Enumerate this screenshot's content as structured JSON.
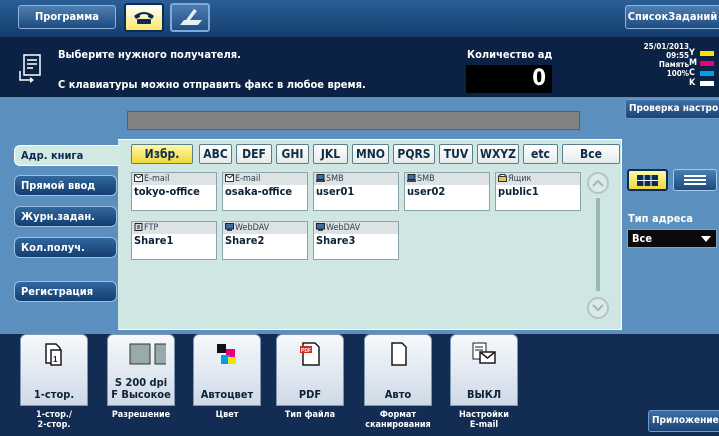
{
  "header": {
    "program_label": "Программа",
    "jobs_label": "СписокЗаданий"
  },
  "message": {
    "line1": "Выберите нужного получателя.",
    "line2": "С клавиатуры можно отправить факс в любое время.",
    "count_label": "Количество ад",
    "count_value": "0"
  },
  "status": {
    "date": "25/01/2013",
    "time": "09:55",
    "memory_label": "Память",
    "memory_value": "100%",
    "toners": [
      {
        "label": "Y",
        "color": "#f2e600"
      },
      {
        "label": "M",
        "color": "#e6007e"
      },
      {
        "label": "C",
        "color": "#00a0e9"
      },
      {
        "label": "K",
        "color": "#ffffff"
      }
    ]
  },
  "check_label": "Проверка настро",
  "nav": {
    "addrbook": "Адр. книга",
    "direct": "Прямой ввод",
    "journal": "Журн.задан.",
    "count": "Кол.получ.",
    "register": "Регистрация"
  },
  "tabs": [
    "Избр.",
    "ABC",
    "DEF",
    "GHI",
    "JKL",
    "MNO",
    "PQRS",
    "TUV",
    "WXYZ",
    "etc",
    "Все"
  ],
  "destinations": [
    {
      "type": "E-mail",
      "name": "tokyo-office",
      "icon": "email-icon"
    },
    {
      "type": "E-mail",
      "name": "osaka-office",
      "icon": "email-icon"
    },
    {
      "type": "SMB",
      "name": "user01",
      "icon": "smb-icon"
    },
    {
      "type": "SMB",
      "name": "user02",
      "icon": "smb-icon"
    },
    {
      "type": "Ящик",
      "name": "public1",
      "icon": "box-icon"
    },
    {
      "type": "FTP",
      "name": "Share1",
      "icon": "ftp-icon"
    },
    {
      "type": "WebDAV",
      "name": "Share2",
      "icon": "webdav-icon"
    },
    {
      "type": "WebDAV",
      "name": "Share3",
      "icon": "webdav-icon"
    }
  ],
  "address_type": {
    "label": "Тип адреса",
    "value": "Все"
  },
  "settings": [
    {
      "value_line1": "1-стор.",
      "value_line2": "",
      "label_line1": "1-стор./",
      "label_line2": "2-стор.",
      "icon": "simplex-icon"
    },
    {
      "value_line1": "S 200 dpi",
      "value_line2": "F Высокое",
      "label_line1": "Разрешение",
      "label_line2": "",
      "icon": "resolution-icon"
    },
    {
      "value_line1": "Автоцвет",
      "value_line2": "",
      "label_line1": "Цвет",
      "label_line2": "",
      "icon": "color-icon"
    },
    {
      "value_line1": "PDF",
      "value_line2": "",
      "label_line1": "Тип файла",
      "label_line2": "",
      "icon": "pdf-icon"
    },
    {
      "value_line1": "Авто",
      "value_line2": "",
      "label_line1": "Формат",
      "label_line2": "сканирования",
      "icon": "page-icon"
    },
    {
      "value_line1": "ВЫКЛ",
      "value_line2": "",
      "label_line1": "Настройки",
      "label_line2": "E-mail",
      "icon": "email-settings-icon"
    }
  ],
  "app_label": "Приложение"
}
